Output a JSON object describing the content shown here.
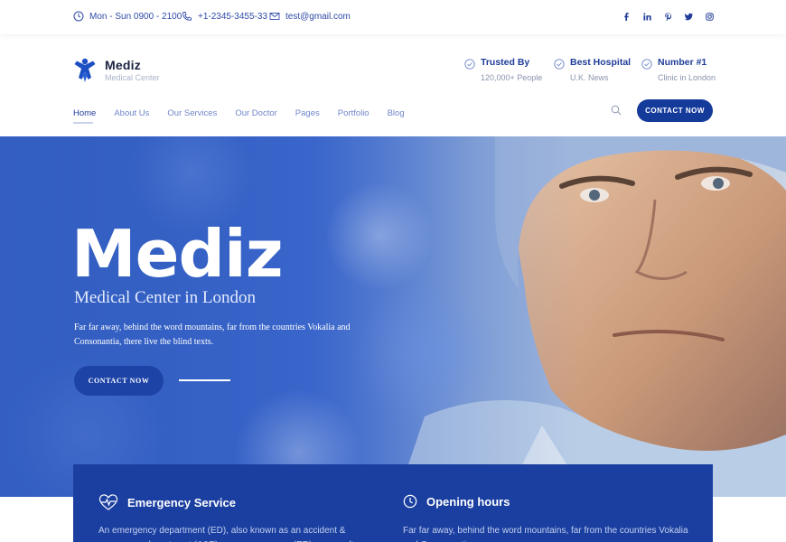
{
  "topbar": {
    "hours": "Mon - Sun 0900 - 2100",
    "phone": "+1-2345-3455-33",
    "email": "test@gmail.com",
    "social_icons": [
      "facebook-icon",
      "linkedin-icon",
      "pinterest-icon",
      "twitter-icon",
      "instagram-icon"
    ]
  },
  "header": {
    "brand": "Mediz",
    "brand_sub": "Medical Center",
    "badges": [
      {
        "title": "Trusted By",
        "subtitle": "120,000+ People"
      },
      {
        "title": "Best Hospital",
        "subtitle": "U.K. News"
      },
      {
        "title": "Number #1",
        "subtitle": "Clinic in London"
      }
    ],
    "nav": [
      "Home",
      "About Us",
      "Our Services",
      "Our Doctor",
      "Pages",
      "Portfolio",
      "Blog"
    ],
    "contact_label": "CONTACT NOW"
  },
  "hero": {
    "title": "Mediz",
    "subtitle": "Medical Center in London",
    "text": "Far far away, behind the word mountains, far from the countries Vokalia and Consonantia, there live the blind texts.",
    "button_label": "CONTACT NOW"
  },
  "info": {
    "emergency_title": "Emergency Service",
    "emergency_text": "An emergency department (ED), also known as an accident & emergency department (A&E), emergency room (ER) or casualty",
    "hours_title": "Opening hours",
    "hours_text": "Far far away, behind the word mountains, far from the countries Vokalia and Consonantia"
  },
  "colors": {
    "primary": "#1b3fa0",
    "accent": "#2f4aa8",
    "muted": "#8a94ad"
  }
}
